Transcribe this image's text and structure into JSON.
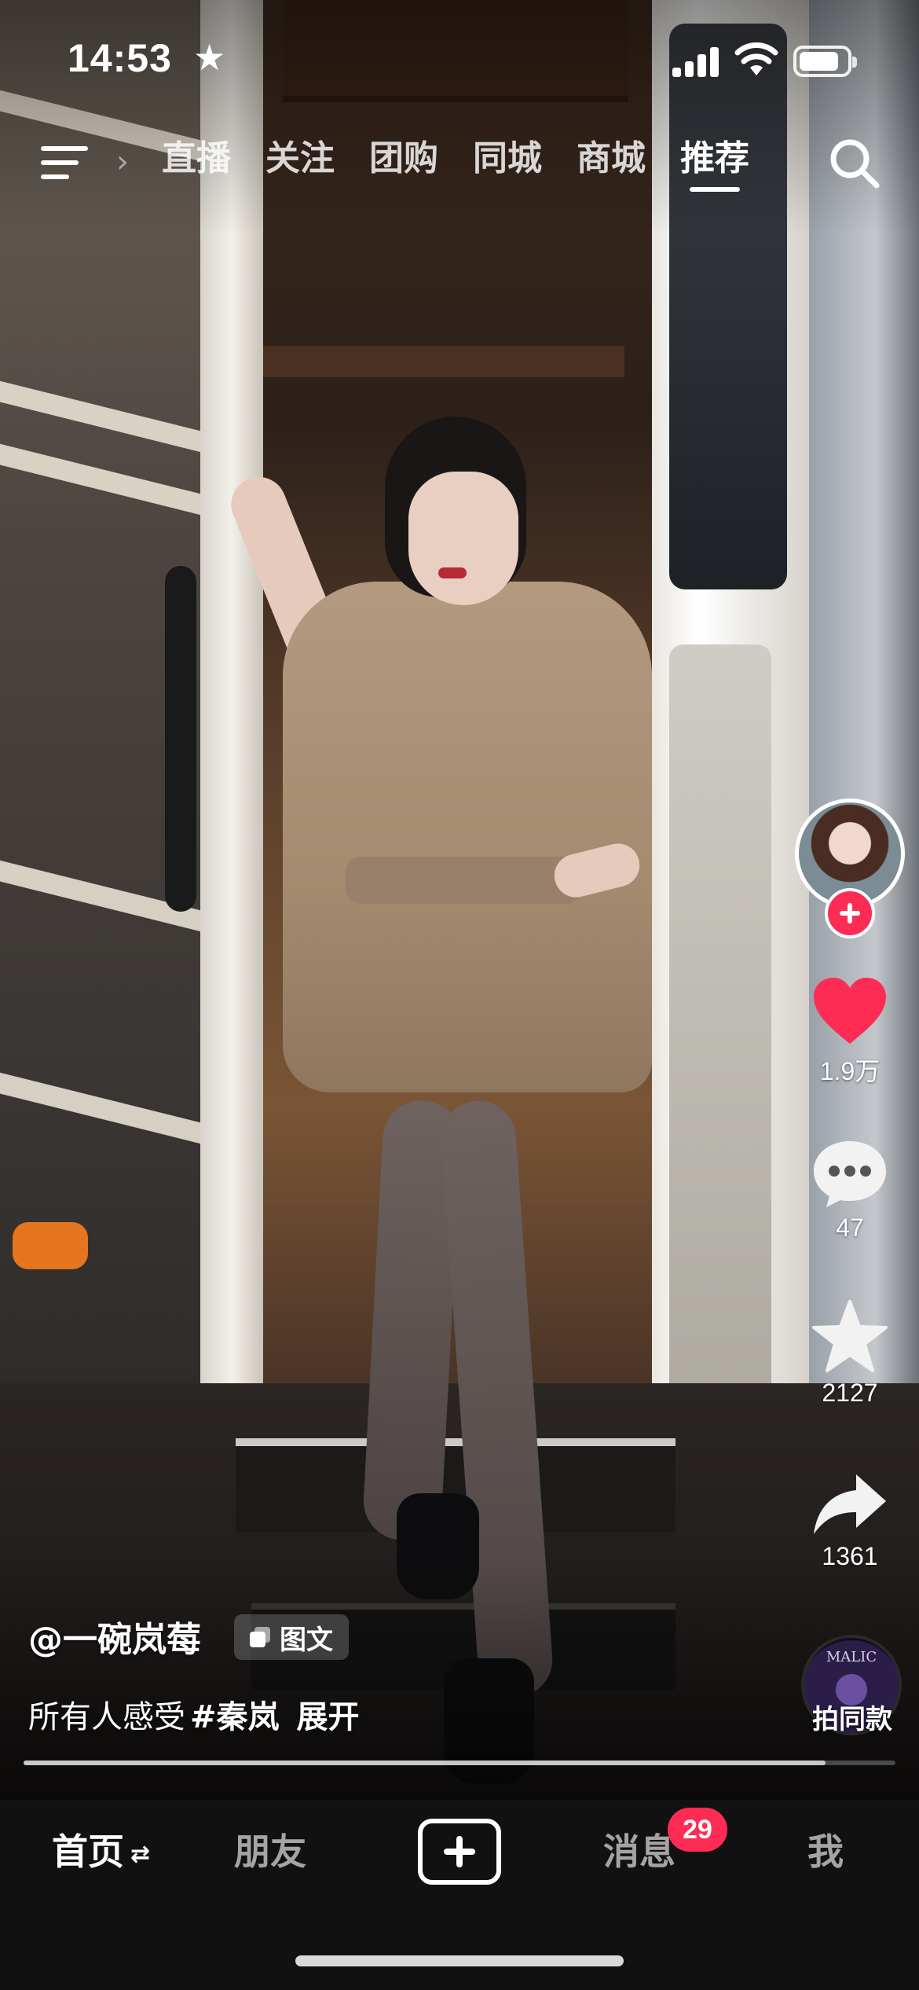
{
  "status_bar": {
    "time": "14:53",
    "battery_level": 0.85
  },
  "top_nav": {
    "tabs": [
      {
        "label": "直播",
        "active": false
      },
      {
        "label": "关注",
        "active": false
      },
      {
        "label": "团购",
        "active": false
      },
      {
        "label": "同城",
        "active": false
      },
      {
        "label": "商城",
        "active": false
      },
      {
        "label": "推荐",
        "active": true
      }
    ]
  },
  "right_rail": {
    "likes": "1.9万",
    "comments": "47",
    "favorites": "2127",
    "shares": "1361",
    "music_disc_text": "MALIC",
    "shoot_same_label": "拍同款"
  },
  "post": {
    "author": "@一碗岚莓",
    "type_tag": "图文",
    "caption_text": "所有人感受",
    "hashtag": "#秦岚",
    "expand_label": "展开",
    "progress": 0.92
  },
  "bottom_nav": {
    "home": "首页",
    "friends": "朋友",
    "messages": "消息",
    "messages_badge": "29",
    "me": "我"
  },
  "colors": {
    "accent_red": "#fe2c55",
    "bar_bg": "#111111"
  },
  "icons": [
    "menu-icon",
    "search-icon",
    "heart-icon",
    "comment-icon",
    "star-icon",
    "share-icon",
    "plus-icon",
    "album-icon"
  ]
}
